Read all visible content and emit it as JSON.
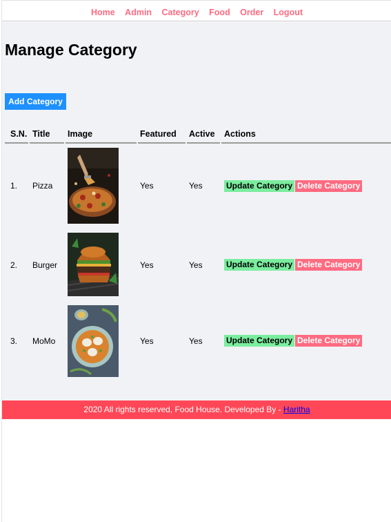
{
  "menu": {
    "items": [
      {
        "label": "Home"
      },
      {
        "label": "Admin"
      },
      {
        "label": "Category"
      },
      {
        "label": "Food"
      },
      {
        "label": "Order"
      },
      {
        "label": "Logout"
      }
    ]
  },
  "page": {
    "title": "Manage Category",
    "add_button": "Add Category"
  },
  "table": {
    "headers": [
      "S.N.",
      "Title",
      "Image",
      "Featured",
      "Active",
      "Actions"
    ],
    "rows": [
      {
        "sn": "1.",
        "title": "Pizza",
        "image": "pizza",
        "featured": "Yes",
        "active": "Yes",
        "update": "Update Category",
        "delete": "Delete Category"
      },
      {
        "sn": "2.",
        "title": "Burger",
        "image": "burger",
        "featured": "Yes",
        "active": "Yes",
        "update": "Update Category",
        "delete": "Delete Category"
      },
      {
        "sn": "3.",
        "title": "MoMo",
        "image": "momo",
        "featured": "Yes",
        "active": "Yes",
        "update": "Update Category",
        "delete": "Delete Category"
      }
    ]
  },
  "footer": {
    "text": "2020 All rights reserved, Food House. Developed By - ",
    "link": "Haritha"
  },
  "colors": {
    "menu_link": "#ff6b81",
    "add_button": "#1e90ff",
    "update_button": "#7bed9f",
    "delete_button": "#ff6b81",
    "footer": "#ff4757",
    "main_bg": "#f1f2f6"
  }
}
